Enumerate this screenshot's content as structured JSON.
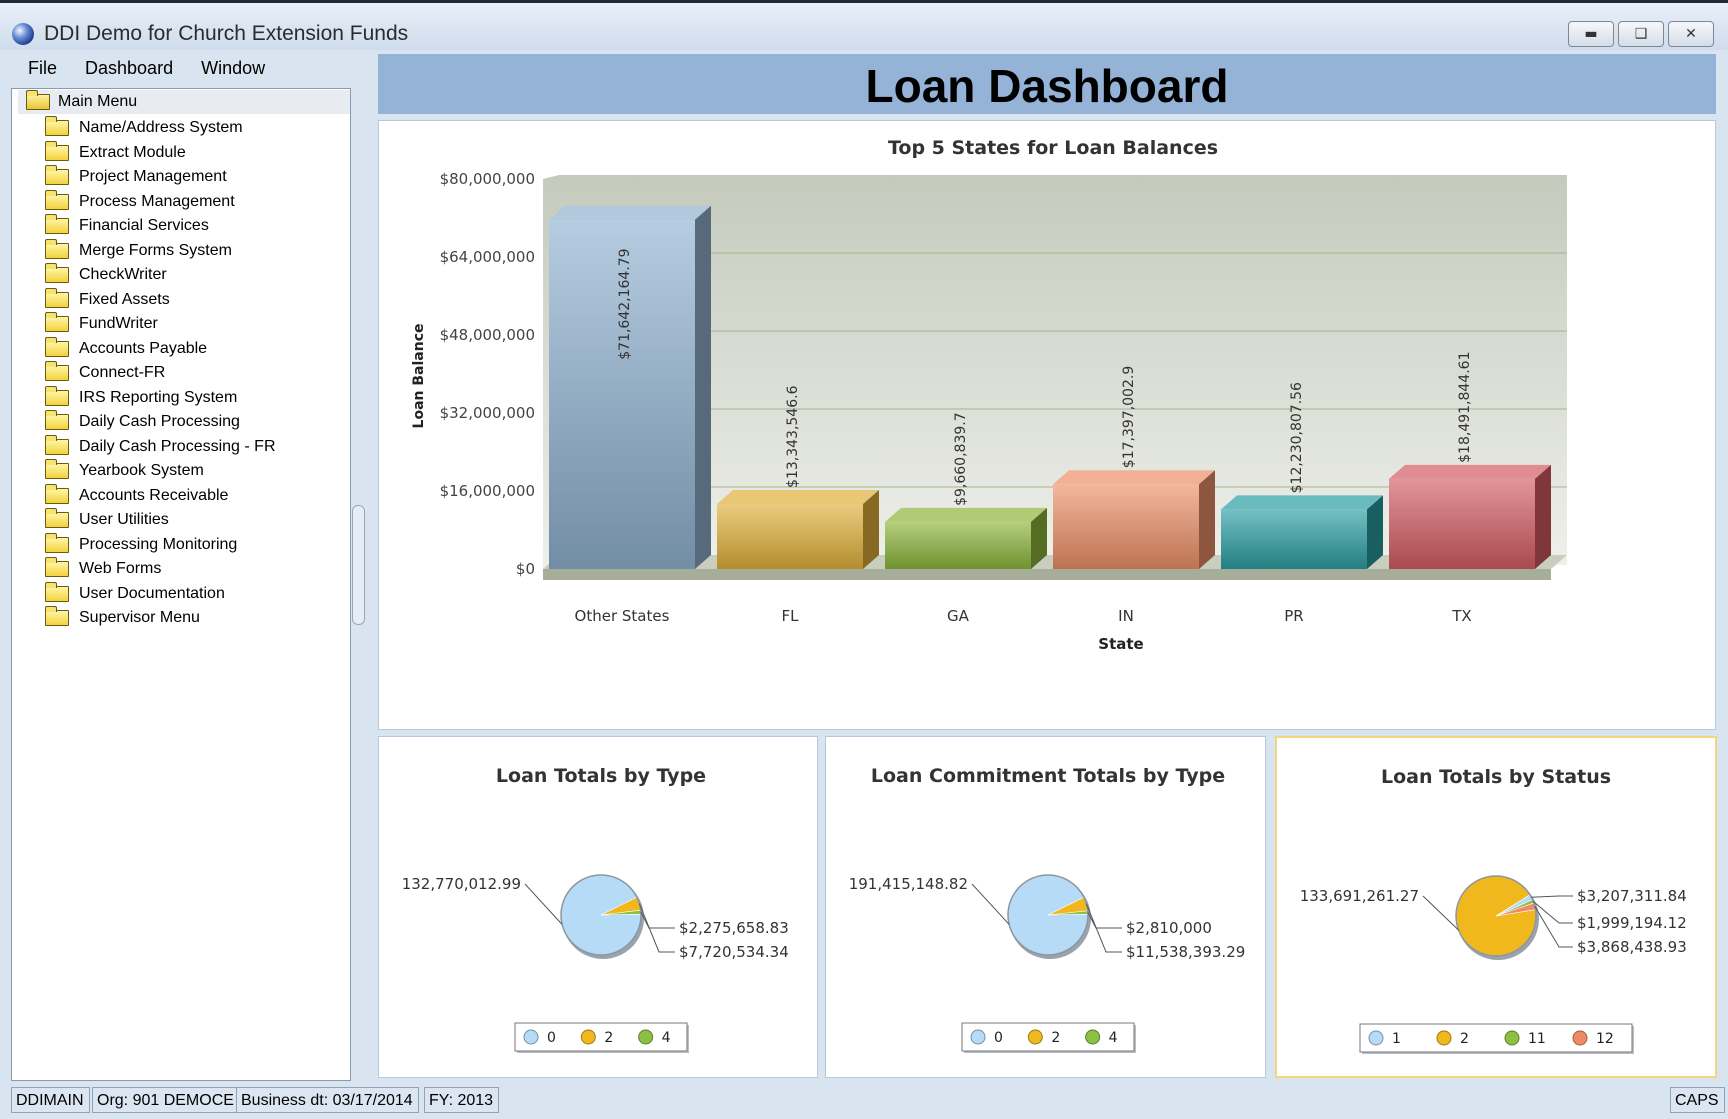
{
  "window": {
    "title": "DDI Demo for Church Extension Funds",
    "minimize_icon": "minimize-icon",
    "maximize_icon": "maximize-icon",
    "close_icon": "close-icon"
  },
  "menubar": {
    "items": [
      "File",
      "Dashboard",
      "Window"
    ]
  },
  "tree": {
    "root": "Main Menu",
    "items": [
      "Name/Address System",
      "Extract Module",
      "Project Management",
      "Process Management",
      "Financial Services",
      "Merge Forms System",
      "CheckWriter",
      "Fixed Assets",
      "FundWriter",
      "Accounts Payable",
      "Connect-FR",
      "IRS Reporting System",
      "Daily Cash Processing",
      "Daily Cash Processing - FR",
      "Yearbook System",
      "Accounts Receivable",
      "User Utilities",
      "Processing Monitoring",
      "Web Forms",
      "User Documentation",
      "Supervisor Menu"
    ]
  },
  "dashboard": {
    "title": "Loan Dashboard"
  },
  "status": {
    "module": "DDIMAIN",
    "org": "Org: 901 DEMOCE",
    "business_date": "Business dt: 03/17/2014",
    "fy": "FY: 2013",
    "caps": "CAPS"
  },
  "chart_data": [
    {
      "type": "bar",
      "title": "Top 5 States for Loan Balances",
      "xlabel": "State",
      "ylabel": "Loan Balance",
      "categories": [
        "Other States",
        "FL",
        "GA",
        "IN",
        "PR",
        "TX"
      ],
      "values": [
        71642164.79,
        13343546.6,
        9660839.7,
        17397002.9,
        12230807.56,
        18491844.61
      ],
      "value_labels": [
        "$71,642,164.79",
        "$13,343,546.6",
        "$9,660,839.7",
        "$17,397,002.9",
        "$12,230,807.56",
        "$18,491,844.61"
      ],
      "yticks": [
        "$0",
        "$16,000,000",
        "$32,000,000",
        "$48,000,000",
        "$64,000,000",
        "$80,000,000"
      ],
      "ylim": [
        0,
        80000000
      ],
      "grid": true,
      "colors": [
        "#8fb0cf",
        "#e0b03a",
        "#8cb53a",
        "#ec9068",
        "#2a9ea2",
        "#d35c63"
      ]
    },
    {
      "type": "pie",
      "title": "Loan Totals by Type",
      "values": [
        132770012.99,
        7720534.34,
        2275658.83
      ],
      "labels": [
        "132,770,012.99",
        "$7,720,534.34",
        "$2,275,658.83"
      ],
      "colors": [
        "#b5dbf7",
        "#f0b81c",
        "#8cc043"
      ],
      "legend": [
        "0",
        "2",
        "4"
      ],
      "legend_colors": [
        "#b5dbf7",
        "#f0b81c",
        "#8cc043"
      ],
      "legend_position": "bottom"
    },
    {
      "type": "pie",
      "title": "Loan Commitment Totals by Type",
      "values": [
        191415148.82,
        11538393.29,
        2810000
      ],
      "labels": [
        "191,415,148.82",
        "$11,538,393.29",
        "$2,810,000"
      ],
      "colors": [
        "#b5dbf7",
        "#f0b81c",
        "#8cc043"
      ],
      "legend": [
        "0",
        "2",
        "4"
      ],
      "legend_colors": [
        "#b5dbf7",
        "#f0b81c",
        "#8cc043"
      ],
      "legend_position": "bottom"
    },
    {
      "type": "pie",
      "title": "Loan Totals by Status",
      "values": [
        133691261.27,
        3207311.84,
        1999194.12,
        3868438.93
      ],
      "labels": [
        "133,691,261.27",
        "$3,207,311.84",
        "$1,999,194.12",
        "$3,868,438.93"
      ],
      "colors": [
        "#f0b81c",
        "#b5dbf7",
        "#8cc043",
        "#ef8a66"
      ],
      "legend": [
        "1",
        "2",
        "11",
        "12"
      ],
      "legend_colors": [
        "#b5dbf7",
        "#f0b81c",
        "#8cc043",
        "#ef8a66"
      ],
      "legend_position": "bottom"
    }
  ]
}
